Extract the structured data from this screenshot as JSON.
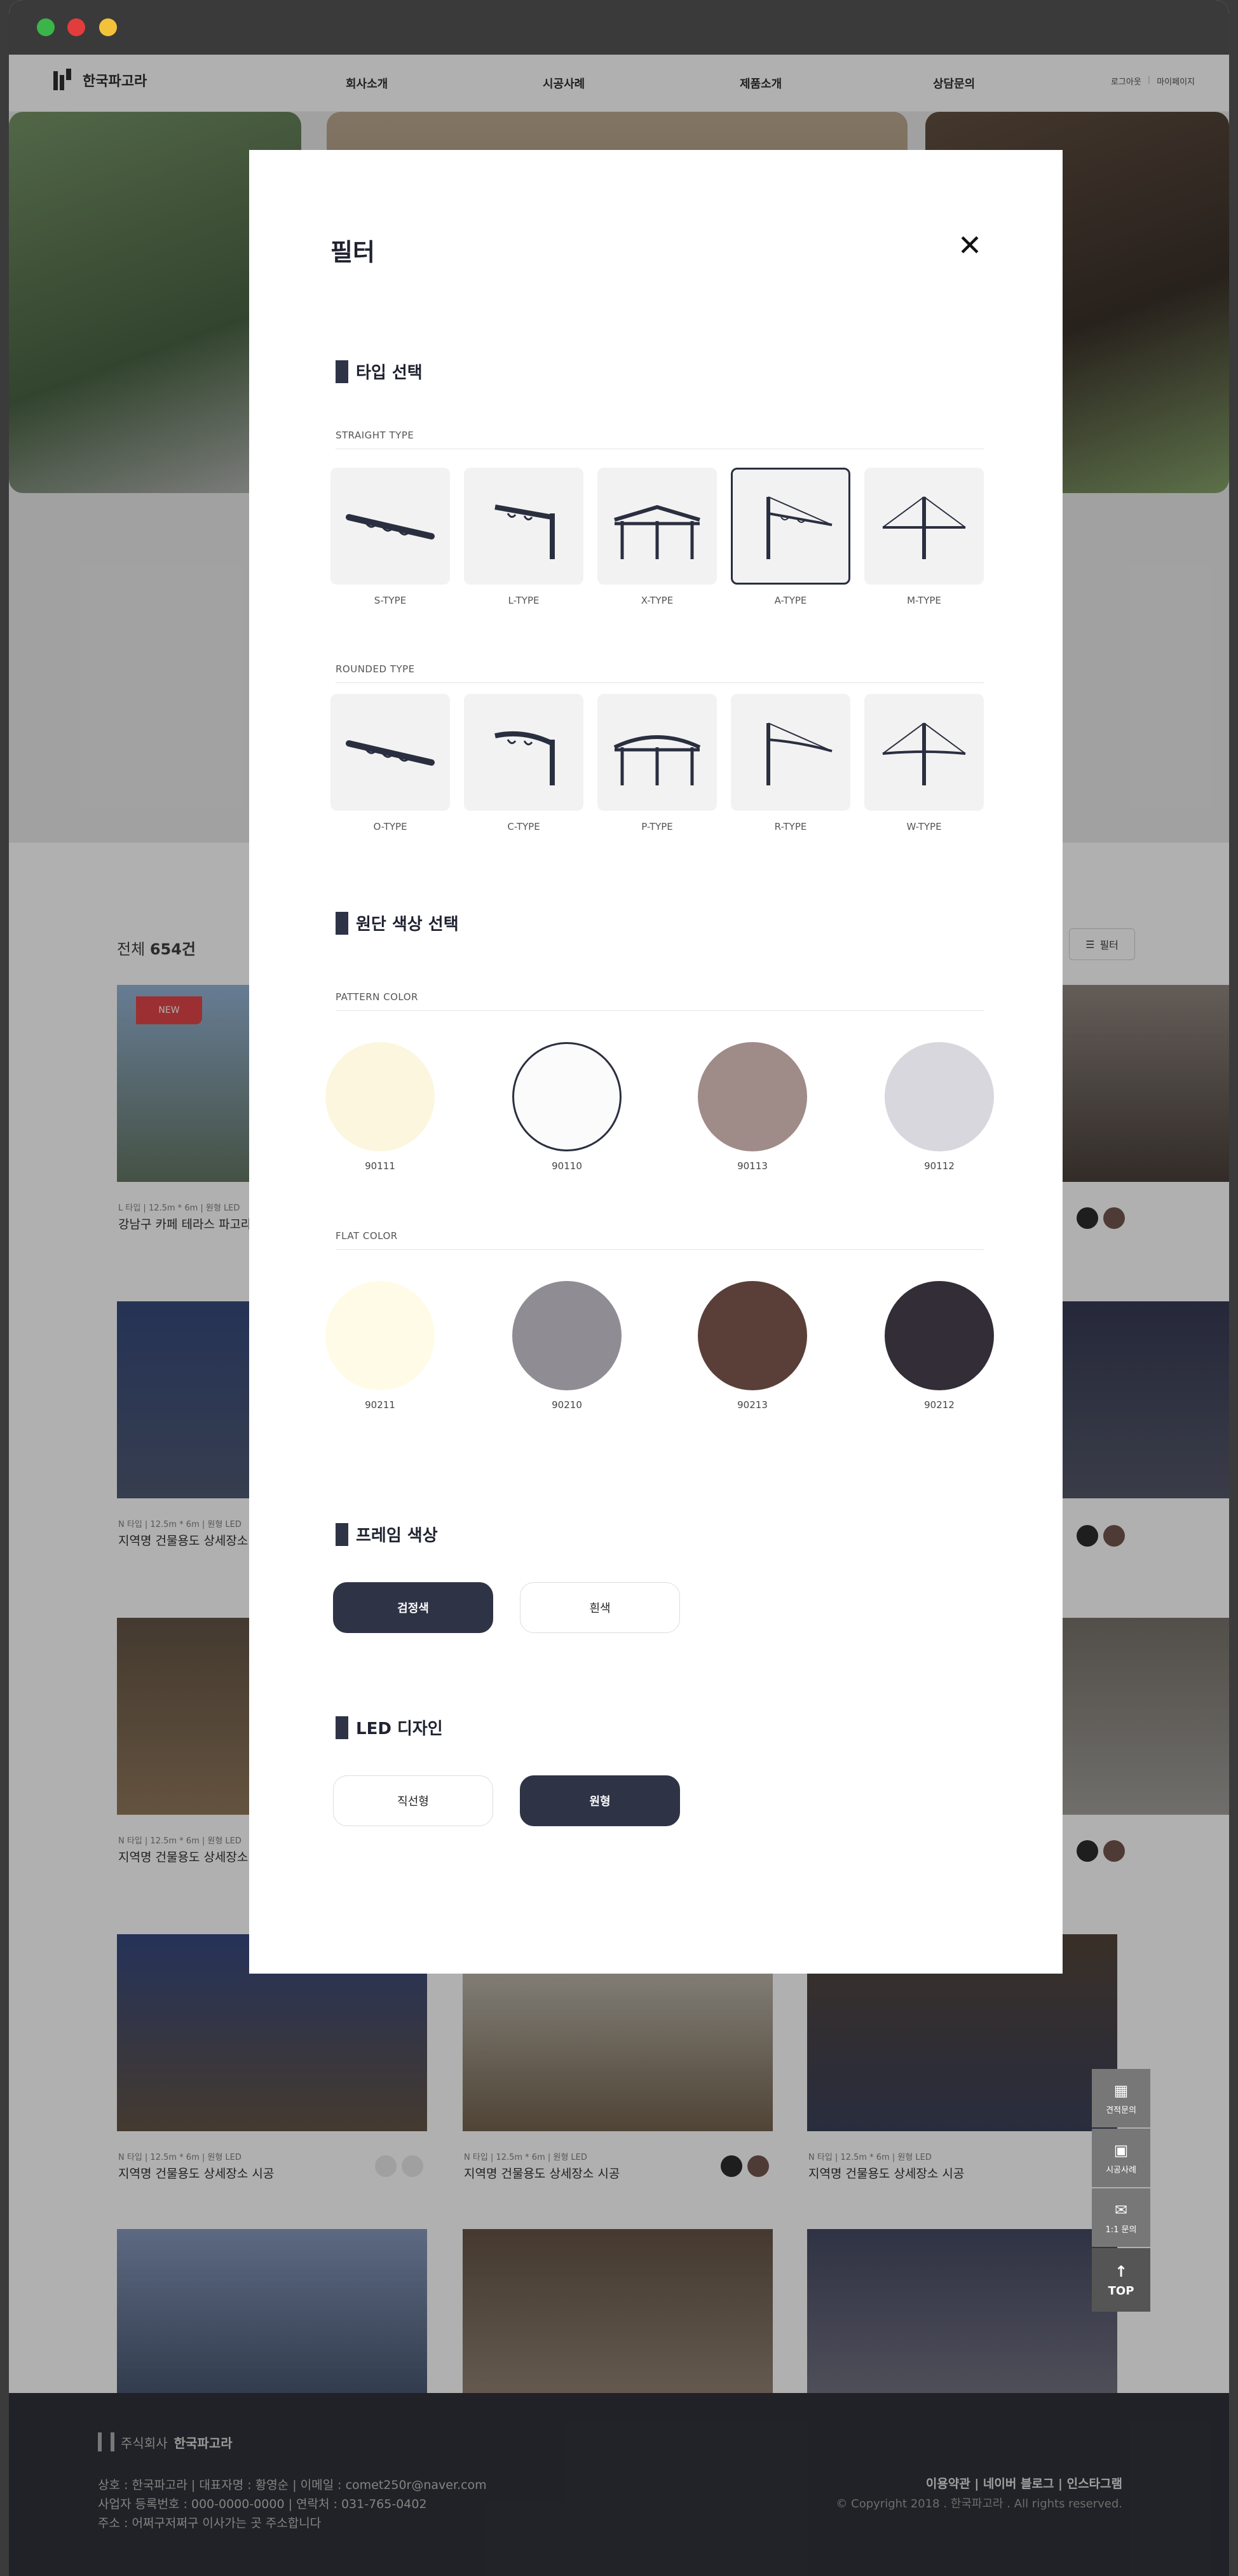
{
  "browser": {
    "dots": [
      "#3bb54a",
      "#e33c3c",
      "#f2c33a"
    ]
  },
  "nav": {
    "logo": "한국파고라",
    "menu": [
      "회사소개",
      "시공사례",
      "제품소개",
      "상담문의"
    ],
    "util": [
      "로그아웃",
      "마이페이지"
    ]
  },
  "list": {
    "count_prefix": "전체",
    "count_value": "654건",
    "filter_label": "필터",
    "new_badge": "NEW",
    "cards": [
      {
        "meta": "L 타입 | 12.5m * 6m | 원형 LED",
        "title": "강남구 카페 테라스 파고라 시공"
      },
      {
        "meta": "N 타입 | 12.5m * 6m | 원형 LED",
        "title": "지역명 건물용도 상세장소 시공"
      },
      {
        "meta": "N 타입 | 12.5m * 6m | 원형 LED",
        "title": "지역명 건물용도 상세장소 시공"
      },
      {
        "meta": "N 타입 | 12.5m * 6m | 원형 LED",
        "title": "지역명 건물용도 상세장소 시공"
      },
      {
        "meta": "N 타입 | 12.5m * 6m | 원형 LED",
        "title": "지역명 건물용도 상세장소 시공"
      },
      {
        "meta": "N 타입 | 12.5m * 6m | 원형 LED",
        "title": "지역명 건물용도 상세장소 시공"
      }
    ]
  },
  "side": {
    "items": [
      "견적문의",
      "시공사례",
      "1:1 문의",
      "TOP"
    ]
  },
  "footer": {
    "company_prefix": "주식회사",
    "company": "한국파고라",
    "line1": "상호 : 한국파고라 | 대표자명 : 황영순 | 이메일 : comet250r@naver.com",
    "line2": "사업자 등록번호 : 000-0000-0000 | 연락처 : 031-765-0402",
    "line3": "주소 : 어쩌구저쩌구 이사가는 곳 주소합니다",
    "links": "이용약관 | 네이버 블로그 | 인스타그램",
    "copyright": "© Copyright 2018 . 한국파고라 . All rights reserved."
  },
  "modal": {
    "title": "필터",
    "close": "✕",
    "type_section": "타입 선택",
    "straight_label": "STRAIGHT TYPE",
    "straight_types": [
      "S-TYPE",
      "L-TYPE",
      "X-TYPE",
      "A-TYPE",
      "M-TYPE"
    ],
    "rounded_label": "ROUNDED TYPE",
    "rounded_types": [
      "O-TYPE",
      "C-TYPE",
      "P-TYPE",
      "R-TYPE",
      "W-TYPE"
    ],
    "selected_type": "A-TYPE",
    "fabric_section": "원단 색상 선택",
    "pattern_label": "PATTERN COLOR",
    "pattern_colors": [
      {
        "code": "90111",
        "color": "#fcf6df"
      },
      {
        "code": "90110",
        "color": "#fbfbfb"
      },
      {
        "code": "90113",
        "color": "#9f8b87"
      },
      {
        "code": "90112",
        "color": "#d8d7de"
      }
    ],
    "flat_label": "FLAT COLOR",
    "flat_colors": [
      {
        "code": "90211",
        "color": "#fffbe6"
      },
      {
        "code": "90210",
        "color": "#8f8c94"
      },
      {
        "code": "90213",
        "color": "#5a3f39"
      },
      {
        "code": "90212",
        "color": "#332d37"
      }
    ],
    "frame_section": "프레임 색상",
    "frame_options": [
      "검정색",
      "흰색"
    ],
    "led_section": "LED 디자인",
    "led_options": [
      "직선형",
      "원형"
    ]
  }
}
